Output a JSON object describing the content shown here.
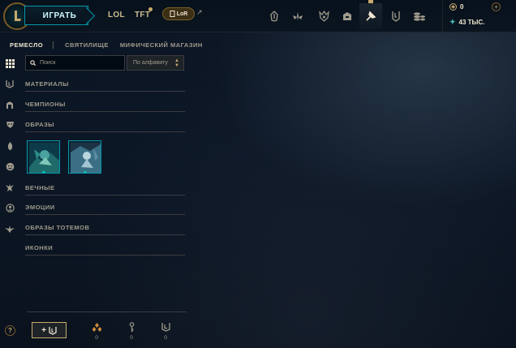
{
  "header": {
    "play_label": "ИГРАТЬ",
    "modes": [
      {
        "label": "LOL"
      },
      {
        "label": "TFT"
      },
      {
        "label": "LoR"
      }
    ],
    "nav_icons": [
      "home-icon",
      "tft-icon",
      "profile-icon",
      "collection-icon",
      "loot-icon",
      "clash-icon",
      "store-icon"
    ],
    "active_nav": "loot-icon"
  },
  "currency": {
    "rp": "0",
    "blue_essence": "43 ТЫС."
  },
  "subnav": {
    "items": [
      "РЕМЕСЛО",
      "СВЯТИЛИЩЕ",
      "МИФИЧЕСКИЙ МАГАЗИН"
    ],
    "active": "РЕМЕСЛО"
  },
  "filters": {
    "search_placeholder": "Поиск",
    "sort_value": "По алфавиту"
  },
  "categories": [
    {
      "label": "МАТЕРИАЛЫ"
    },
    {
      "label": "ЧЕМПИОНЫ"
    },
    {
      "label": "ОБРАЗЫ"
    },
    {
      "label": "ВЕЧНЫЕ"
    },
    {
      "label": "ЭМОЦИИ"
    },
    {
      "label": "ОБРАЗЫ ТОТЕМОВ"
    },
    {
      "label": "ИКОНКИ"
    }
  ],
  "bottom": {
    "help_label": "?",
    "add_label": "+",
    "loot_counts": [
      {
        "icon": "orange-essence-icon",
        "count": "0"
      },
      {
        "icon": "key-icon",
        "count": "0"
      },
      {
        "icon": "chest-icon",
        "count": "0"
      }
    ]
  },
  "colors": {
    "accent_gold": "#c8aa6e",
    "accent_teal": "#0596aa",
    "background": "#010a13",
    "text_primary": "#f0e6d2",
    "text_secondary": "#a09b8c"
  }
}
